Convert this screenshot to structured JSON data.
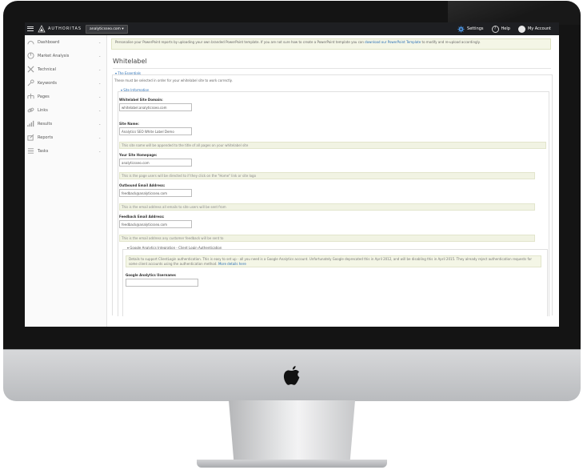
{
  "topbar": {
    "brand": "AUTHORITAS",
    "domain_select": "analyticsseo.com ▾",
    "settings_label": "Settings",
    "help_label": "Help",
    "account_label": "My Account"
  },
  "sidebar": {
    "items": [
      {
        "label": "Dashboard",
        "icon": "dashboard-icon"
      },
      {
        "label": "Market Analysis",
        "icon": "market-analysis-icon"
      },
      {
        "label": "Technical",
        "icon": "technical-icon"
      },
      {
        "label": "Keywords",
        "icon": "keywords-icon"
      },
      {
        "label": "Pages",
        "icon": "pages-icon"
      },
      {
        "label": "Links",
        "icon": "links-icon"
      },
      {
        "label": "Results",
        "icon": "results-icon"
      },
      {
        "label": "Reports",
        "icon": "reports-icon"
      },
      {
        "label": "Tasks",
        "icon": "tasks-icon"
      }
    ]
  },
  "main": {
    "banner_text": "Personalise your PowerPoint reports by uploading your own branded PowerPoint template. If you are not sure how to create a PowerPoint template you can",
    "banner_link": "download our PowerPoint Template",
    "banner_tail": "to modify and re-upload accordingly.",
    "title": "Whitelabel",
    "fs_essentials": "▾ The Essentials",
    "essentials_hint": "These must be selected in order for your whitelabel site to work correctly.",
    "fs_site_info": "▾ Site Information",
    "fields": {
      "domain_label": "Whitelabel Site Domain:",
      "domain_value": "whitelabel.analyticsseo.com",
      "name_label": "Site Name:",
      "name_value": "Analytics SEO White Label Demo",
      "name_help": "This site name will be appended to the title of all pages on your whitelabel site",
      "homepage_label": "Your Site Homepage:",
      "homepage_value": "analyticsseo.com",
      "homepage_help": "This is the page users will be directed to if they click on the \"Home\" link or site logo",
      "outbound_label": "Outbound Email Address:",
      "outbound_value": "feedback@analyticsseo.com",
      "outbound_help": "This is the email address all emails to site users will be sent from",
      "feedback_label": "Feedback Email Address:",
      "feedback_value": "feedback@analyticsseo.com",
      "feedback_help": "This is the email address any customer feedback will be sent to"
    },
    "fs_google": "▾ Google Analytics Integration - Client Login Authentication",
    "google_text": "Details to support ClientLogin authentication. This is easy to set up - all you need is a Google Analytics account. Unfortunately Google deprecated this in April 2012, and will be disabling this in April 2015. They already reject authentication requests for some client accounts using the authentication method.",
    "google_link": "More details here",
    "ga_user_label": "Google Analytics Username:",
    "ga_user_value": ""
  }
}
